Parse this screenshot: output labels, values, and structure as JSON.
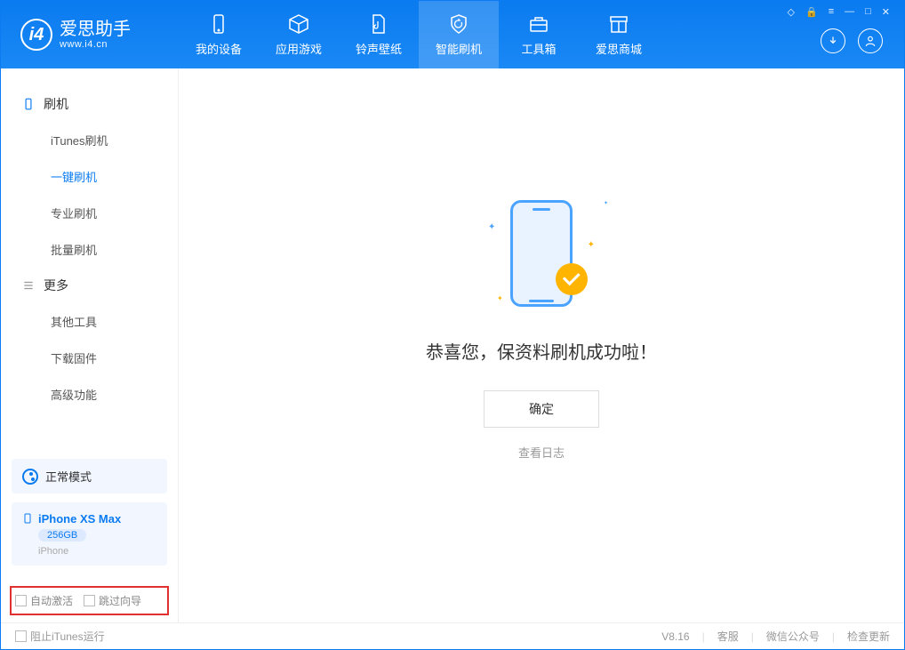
{
  "app": {
    "name": "爱思助手",
    "url": "www.i4.cn"
  },
  "nav": {
    "tabs": [
      {
        "label": "我的设备"
      },
      {
        "label": "应用游戏"
      },
      {
        "label": "铃声壁纸"
      },
      {
        "label": "智能刷机"
      },
      {
        "label": "工具箱"
      },
      {
        "label": "爱思商城"
      }
    ]
  },
  "sidebar": {
    "groups": [
      {
        "title": "刷机",
        "items": [
          {
            "label": "iTunes刷机"
          },
          {
            "label": "一键刷机",
            "active": true
          },
          {
            "label": "专业刷机"
          },
          {
            "label": "批量刷机"
          }
        ]
      },
      {
        "title": "更多",
        "items": [
          {
            "label": "其他工具"
          },
          {
            "label": "下载固件"
          },
          {
            "label": "高级功能"
          }
        ]
      }
    ],
    "mode": "正常模式",
    "device": {
      "name": "iPhone XS Max",
      "storage": "256GB",
      "type": "iPhone"
    },
    "checks": {
      "auto_activate": "自动激活",
      "skip_guide": "跳过向导"
    }
  },
  "main": {
    "message": "恭喜您，保资料刷机成功啦！",
    "ok_button": "确定",
    "log_link": "查看日志"
  },
  "footer": {
    "block_itunes": "阻止iTunes运行",
    "version": "V8.16",
    "links": {
      "service": "客服",
      "wechat": "微信公众号",
      "update": "检查更新"
    }
  }
}
